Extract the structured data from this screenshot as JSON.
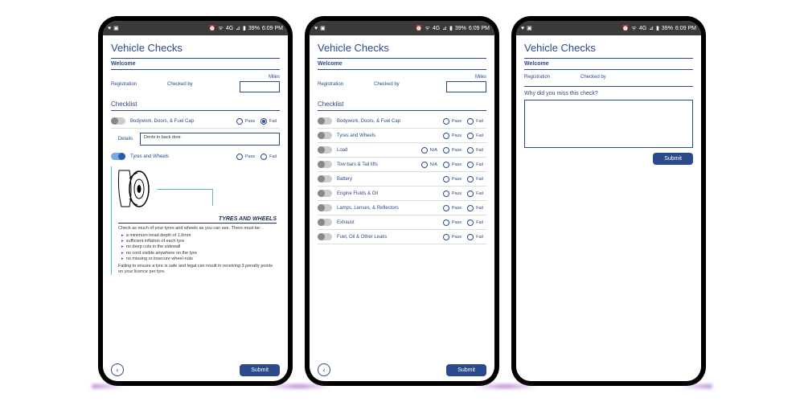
{
  "statusBar": {
    "battery": "39%",
    "time": "6:09 PM"
  },
  "title": "Vehicle Checks",
  "welcome": "Welcome",
  "labels": {
    "registration": "Registration",
    "checkedBy": "Checked by",
    "miles": "Miles",
    "checklist": "Checklist",
    "details": "Details",
    "pass": "Pass",
    "fail": "Fail",
    "na": "N/A",
    "submit": "Submit"
  },
  "detailsValue": "Dents in back door.",
  "phone1": {
    "items": [
      {
        "label": "Bodywork, Doors, & Fuel Cap",
        "on": false,
        "sel": "fail"
      },
      {
        "label": "Tyres and Wheels",
        "on": true,
        "sel": null
      }
    ]
  },
  "phone2": {
    "items": [
      {
        "label": "Bodywork, Doors, & Fuel Cap",
        "na": false
      },
      {
        "label": "Tyres and Wheels",
        "na": false
      },
      {
        "label": "Load",
        "na": true
      },
      {
        "label": "Tow bars & Tail lifts",
        "na": true
      },
      {
        "label": "Battery",
        "na": false
      },
      {
        "label": "Engine Fluids & Oil",
        "na": false
      },
      {
        "label": "Lamps, Lenses, & Reflectors",
        "na": false
      },
      {
        "label": "Exhaust",
        "na": false
      },
      {
        "label": "Fuel, Oil & Other Leaks",
        "na": false
      }
    ]
  },
  "phone3": {
    "question": "Why did you miss this check?"
  },
  "tyres": {
    "heading": "TYRES AND WHEELS",
    "intro": "Check as much of your tyres and wheels as you can see. There must be:",
    "bullets": [
      "a minimum tread depth of 1.6mm",
      "sufficient inflation of each tyre",
      "no deep cuts in the sidewall",
      "no cord visible anywhere on the tyre",
      "no missing or insecure wheel-nuts"
    ],
    "footer": "Failing to ensure a tyre is safe and legal can result in receiving 3 penalty points on your licence per tyre."
  }
}
